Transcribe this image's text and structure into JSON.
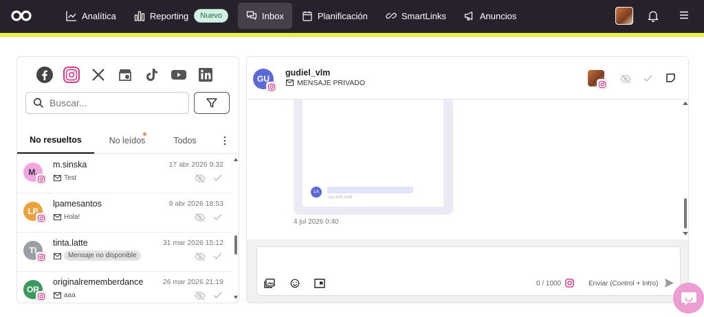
{
  "nav": {
    "items": [
      {
        "label": "Analítica",
        "icon": "chart-line-icon"
      },
      {
        "label": "Reporting",
        "icon": "bar-chart-icon",
        "badge": "Nuevo"
      },
      {
        "label": "Inbox",
        "icon": "inbox-chat-icon",
        "active": true
      },
      {
        "label": "Planificación",
        "icon": "calendar-icon"
      },
      {
        "label": "SmartLinks",
        "icon": "link-icon"
      },
      {
        "label": "Anuncios",
        "icon": "megaphone-icon"
      }
    ]
  },
  "colors": {
    "topbar": "#27212b",
    "accent_strip": "#e9ef4f",
    "instagram": "#d83b8f",
    "fab": "#ec9dd1"
  },
  "left": {
    "socials": [
      "facebook-icon",
      "instagram-icon",
      "x-icon",
      "google-business-icon",
      "tiktok-icon",
      "youtube-icon",
      "linkedin-icon"
    ],
    "search_placeholder": "Buscar...",
    "tabs": [
      "No resueltos",
      "No leídos",
      "Todos"
    ],
    "conversations": [
      {
        "initials": "M.",
        "name": "m.sinska",
        "date": "17 abr 2026 9:32",
        "snippet": "Test",
        "color": "#f2a6e1",
        "initials_color": "#333"
      },
      {
        "initials": "LP",
        "name": "lpamesantos",
        "date": "9 abr 2026 18:53",
        "snippet": "Hola!",
        "color": "#eba13d",
        "initials_color": "#fff"
      },
      {
        "initials": "TI",
        "name": "tinta.latte",
        "date": "31 mar 2026 15:12",
        "snippet": "Mensaje no disponible",
        "pill": true,
        "color": "#9a9fa6",
        "initials_color": "#fff"
      },
      {
        "initials": "OR",
        "name": "originalrememberdance",
        "date": "26 mar 2026 21:19",
        "snippet": "aaa",
        "color": "#3a9a5c",
        "initials_color": "#fff"
      }
    ]
  },
  "chat": {
    "initials": "GU",
    "username": "gudiel_vlm",
    "type": "MENSAJE PRIVADO",
    "preview_initials": "LA",
    "preview_time": "3 jul 2026 14:05",
    "message_time": "4 jul 2026 0:40",
    "counter": "0 / 1000",
    "send_label": "Enviar (Control + Intro)"
  }
}
